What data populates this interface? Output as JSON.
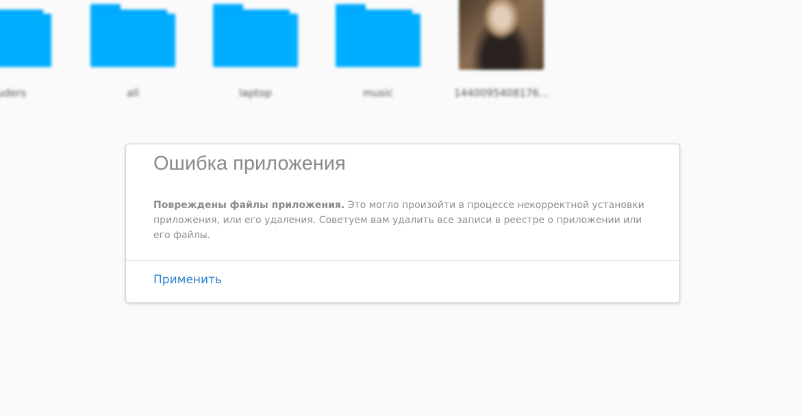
{
  "files": [
    {
      "label": "suders",
      "kind": "folder"
    },
    {
      "label": "all",
      "kind": "folder"
    },
    {
      "label": "laptop",
      "kind": "folder"
    },
    {
      "label": "music",
      "kind": "folder"
    },
    {
      "label": "1440095408176...",
      "kind": "image"
    }
  ],
  "dialog": {
    "title": "Ошибка приложения",
    "message_strong": "Повреждены файлы приложения.",
    "message_rest": " Это могло произойти в процессе некорректной установки приложения, или его удаления. Советуем вам удалить все записи в реестре о приложении или его файлы.",
    "apply_label": "Применить"
  },
  "colors": {
    "folder": "#00aeff",
    "background": "#fafafa",
    "link": "#2f7fd0"
  }
}
